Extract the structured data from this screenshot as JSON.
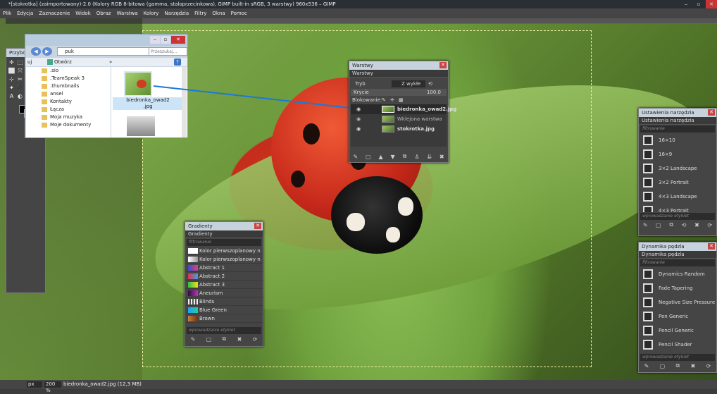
{
  "window": {
    "title": "*[stokrotka] (zaimportowany)-2.0 (Kolory RGB 8-bitowa (gamma, staloprzecinkowa), GIMP built-in sRGB, 3 warstwy) 960x536 – GIMP"
  },
  "menu": [
    "Plik",
    "Edycja",
    "Zaznaczenie",
    "Widok",
    "Obraz",
    "Warstwa",
    "Kolory",
    "Narzędzia",
    "Filtry",
    "Okna",
    "Pomoc"
  ],
  "toolbox": {
    "title": "Przybornik",
    "tools": [
      "✛",
      "⬚",
      "◯",
      "✎",
      "⬜",
      "⤧",
      "⊕",
      "⟲",
      "⊹",
      "✂",
      "⬒",
      "⌘",
      "✦",
      "⬛",
      "✐",
      "⌫",
      "A",
      "◐",
      "⚲",
      "▲"
    ]
  },
  "explorer": {
    "address": "puk",
    "search_placeholder": "Przeszukaj...",
    "organize_label": "uj",
    "open_label": "Otwórz",
    "more_label": "»",
    "folders": [
      ".sio",
      ".TeamSpeak 3",
      ".thumbnails",
      "ansel",
      "Kontakty",
      "Łącza",
      "Moja muzyka",
      "Moje dokumenty"
    ],
    "file_name": "biedronka_owad2.jpg",
    "file_name_line1": "biedronka_owad2",
    "file_name_line2": ".jpg"
  },
  "layers": {
    "title": "Warstwy",
    "tab_label": "Warstwy",
    "mode_label": "Tryb",
    "mode_value": "Z wykłe",
    "opacity_label": "Krycie",
    "opacity_value": "100,0",
    "lock_label": "Blokowanie:",
    "items": [
      {
        "name": "biedronka_owad2.jpg",
        "bold": true
      },
      {
        "name": "Wklejona warstwa",
        "bold": false
      },
      {
        "name": "stokrotka.jpg",
        "bold": true
      }
    ]
  },
  "gradients": {
    "title": "Gradienty",
    "tab_label": "Gradienty",
    "filter_placeholder": "filtrowanie",
    "tag_placeholder": "wprowadzanie etykiet",
    "items": [
      {
        "name": "Kolor pierwszoplanowy n",
        "color": "linear-gradient(90deg,#fff,#fff)"
      },
      {
        "name": "Kolor pierwszoplanowy n",
        "color": "linear-gradient(90deg,#fff,#999)"
      },
      {
        "name": "Abstract 1",
        "color": "linear-gradient(90deg,#3050d0,#e04080)"
      },
      {
        "name": "Abstract 2",
        "color": "linear-gradient(90deg,#e03050,#40a0e0)"
      },
      {
        "name": "Abstract 3",
        "color": "linear-gradient(90deg,#30c040,#f0e020)"
      },
      {
        "name": "Aneurism",
        "color": "linear-gradient(90deg,#2a1040,#c030c0)"
      },
      {
        "name": "Blinds",
        "color": "repeating-linear-gradient(90deg,#eee 0 2px,#555 2px 4px)"
      },
      {
        "name": "Blue Green",
        "color": "linear-gradient(90deg,#20a0f0,#20d0a0)"
      },
      {
        "name": "Brown",
        "color": "linear-gradient(90deg,#c08040,#703010)"
      }
    ]
  },
  "tool_options": {
    "title": "Ustawienia narzędzia",
    "tab_label": "Ustawienia narzędzia",
    "filter_placeholder": "filtrowanie",
    "tag_placeholder": "wprowadzanie etykiet",
    "items": [
      "16×10",
      "16×9",
      "3×2 Landscape",
      "3×2 Portrait",
      "4×3 Landscape",
      "4×3 Portrait"
    ]
  },
  "paint_dynamics": {
    "title": "Dynamika pędzla",
    "tab_label": "Dynamika pędzla",
    "filter_placeholder": "filtrowanie",
    "tag_placeholder": "wprowadzanie etykiet",
    "items": [
      "Dynamics Random",
      "Fade Tapering",
      "Negative Size Pressure",
      "Pen Generic",
      "Pencil Generic",
      "Pencil Shader"
    ]
  },
  "status": {
    "unit": "px",
    "zoom": "200 %",
    "info": "biedronka_owad2.jpg (12,3 MB)"
  },
  "colors": {
    "accent": "#1a78d8",
    "panel_bg": "#454545",
    "panel_head": "#c7d3dc"
  }
}
